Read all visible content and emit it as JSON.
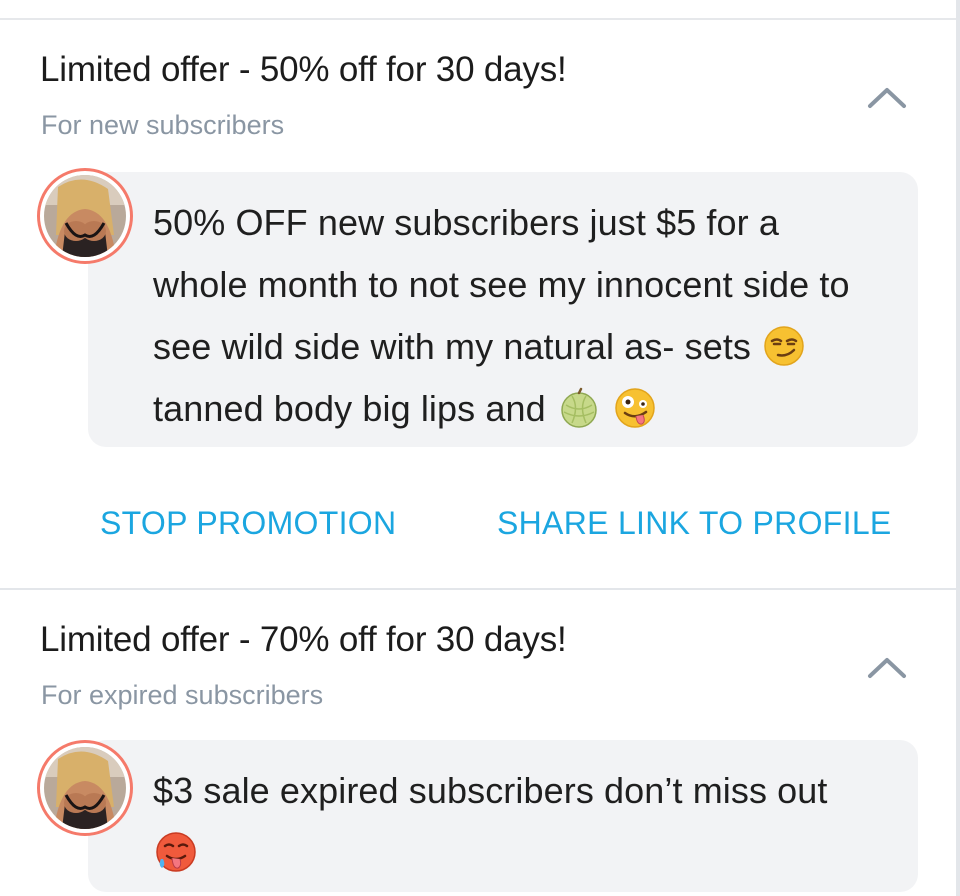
{
  "colors": {
    "accent": "#1ba6e0",
    "title_text": "#1c1c1c",
    "subtitle_text": "#8a96a3",
    "bubble_bg": "#f2f3f5",
    "avatar_ring": "#f57a6a",
    "divider": "#e3e6ea"
  },
  "promotions": [
    {
      "title": "Limited offer - 50% off for 30 days!",
      "subtitle": "For new subscribers",
      "collapse_icon": "chevron-up-icon",
      "message": {
        "text_1": "50% OFF new subscribers just $5 for a whole month to not see my innocent side to see wild side with my natural as- sets",
        "emoji_1": "smirking-face-emoji",
        "text_2": "tanned body big lips and",
        "emoji_2": "melon-emoji",
        "emoji_3": "zany-face-emoji"
      },
      "actions": {
        "stop_label": "STOP PROMOTION",
        "share_label": "SHARE LINK TO PROFILE"
      }
    },
    {
      "title": "Limited offer - 70% off for 30 days!",
      "subtitle": "For expired subscribers",
      "collapse_icon": "chevron-up-icon",
      "message": {
        "text_1": "$3 sale expired subscribers don’t miss out",
        "emoji_1": "hot-face-emoji"
      }
    }
  ]
}
